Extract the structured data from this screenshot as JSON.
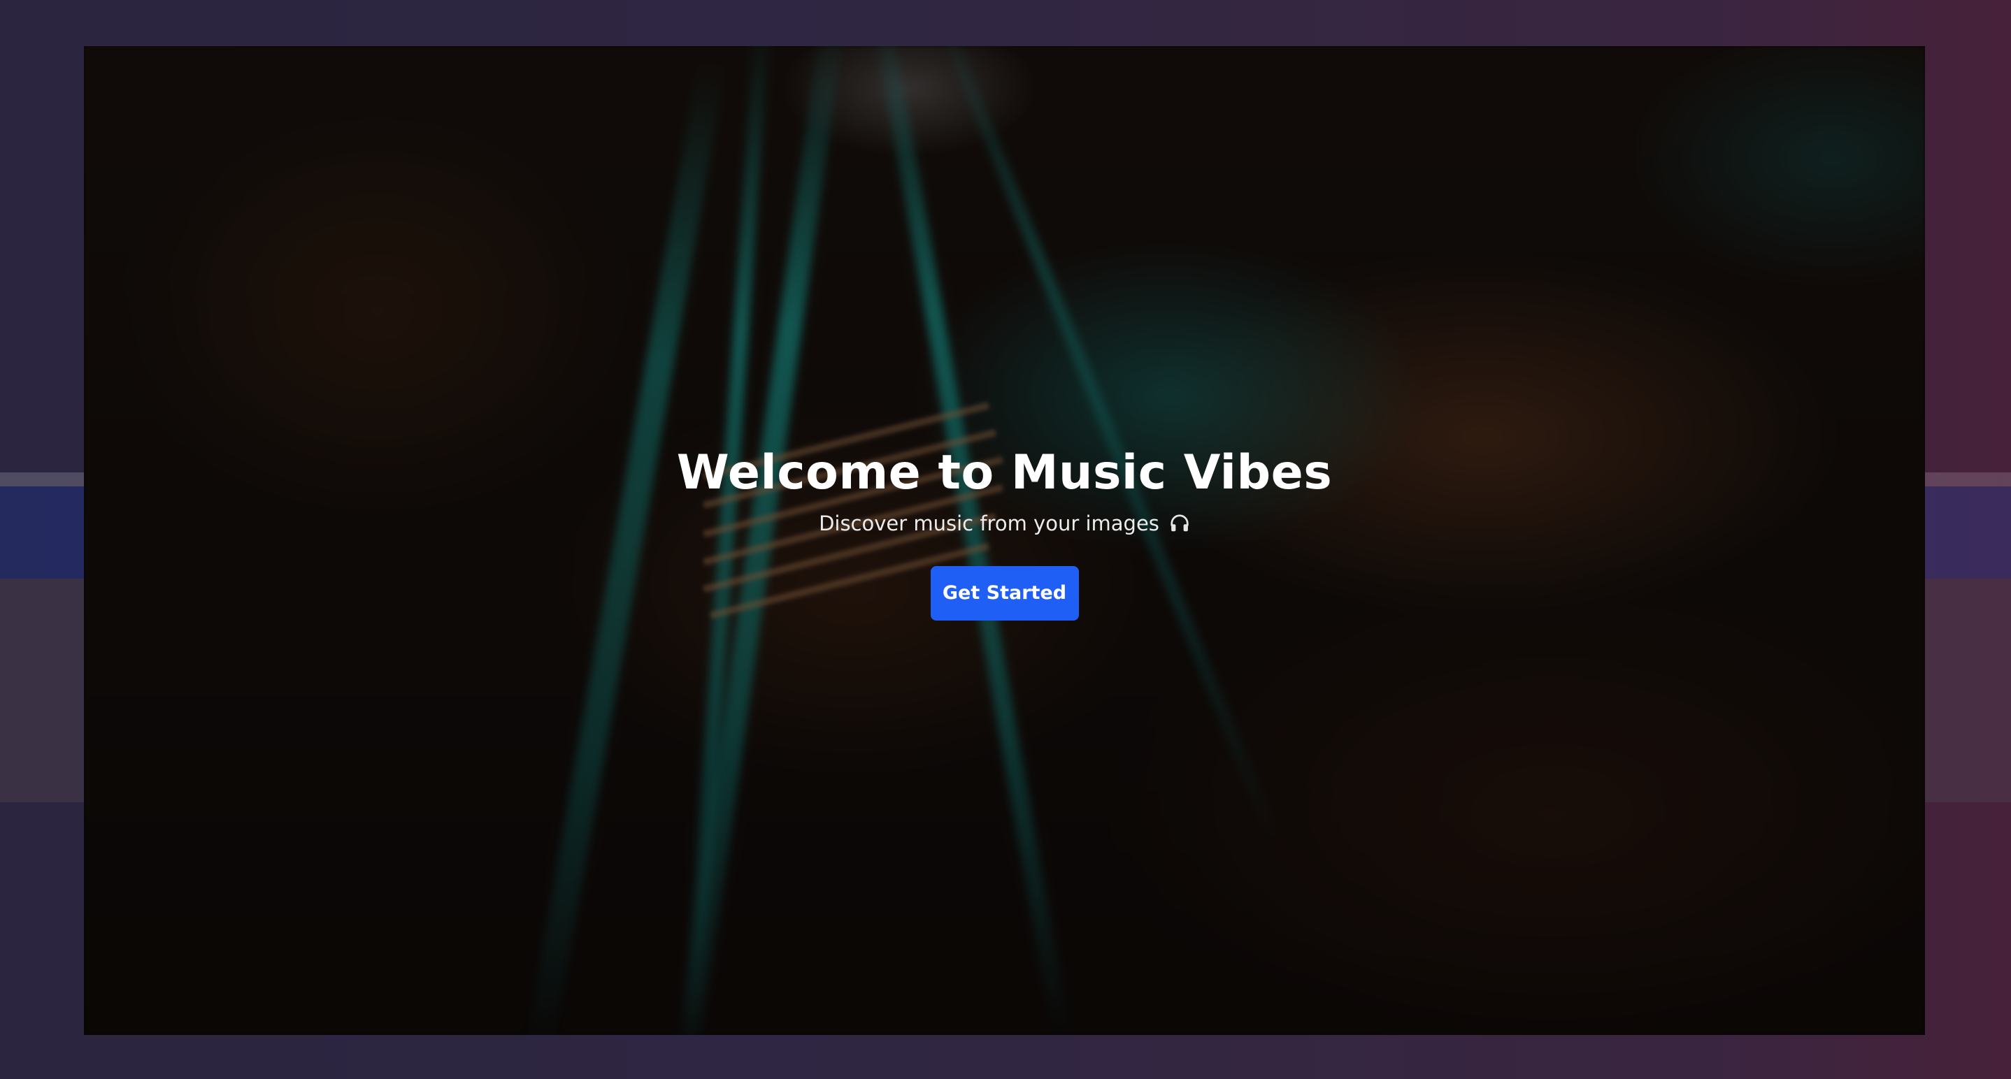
{
  "hero": {
    "title": "Welcome to Music Vibes",
    "subtitle": "Discover music from your images",
    "subtitle_icon": "headphones-icon",
    "cta_label": "Get Started"
  },
  "colors": {
    "cta_background": "#1f5ff5",
    "page_background": "#2b2540",
    "string_accent": "#1eaaa0"
  }
}
